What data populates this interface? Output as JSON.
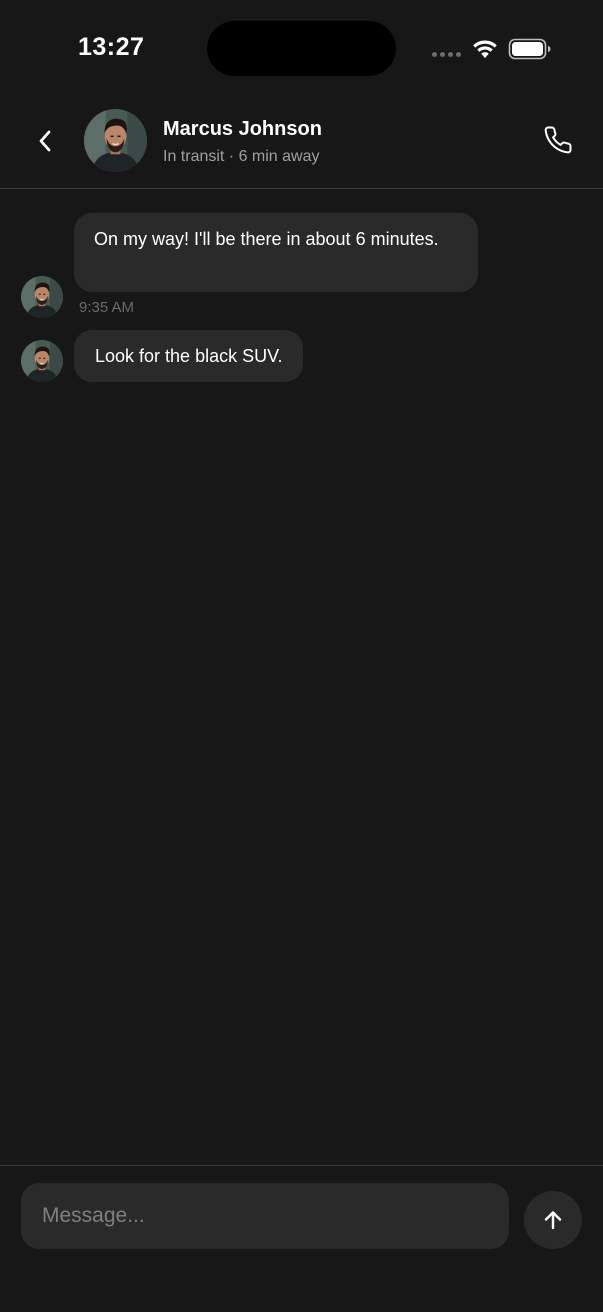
{
  "status_bar": {
    "time": "13:27",
    "icons": [
      "cellular-signal-icon",
      "wifi-icon",
      "battery-icon"
    ]
  },
  "header": {
    "back_icon": "chevron-left-icon",
    "contact_name": "Marcus Johnson",
    "contact_status": "In transit · 6 min away",
    "call_icon": "phone-icon"
  },
  "messages": [
    {
      "sender": "Marcus Johnson",
      "text": "On my way! I'll be there in about 6 minutes.",
      "timestamp": "9:35 AM"
    },
    {
      "sender": "Marcus Johnson",
      "text": "Look for the black SUV."
    }
  ],
  "composer": {
    "placeholder": "Message...",
    "value": "",
    "send_icon": "arrow-up-icon"
  },
  "colors": {
    "background": "#171717",
    "bubble": "#2a2a2a",
    "divider": "#3a3a3a",
    "secondary_text": "#a0a0a0",
    "timestamp_text": "#6a6a6a"
  }
}
